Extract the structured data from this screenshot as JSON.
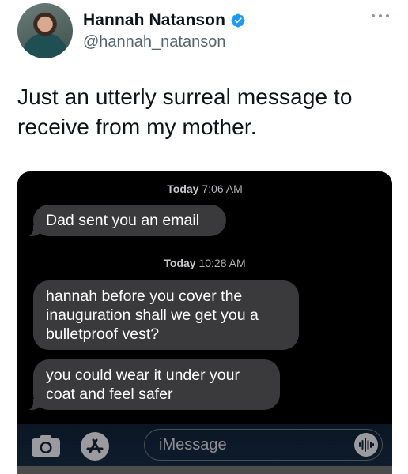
{
  "author": {
    "display_name": "Hannah Natanson",
    "handle": "@hannah_natanson",
    "verified": true,
    "verified_color": "#1d9bf0"
  },
  "tweet": {
    "text": "Just an utterly surreal message to receive from my mother."
  },
  "screenshot": {
    "messages": [
      {
        "timestamp_day": "Today",
        "timestamp_time": "7:06 AM"
      },
      {
        "bubble": "Dad sent you an email"
      },
      {
        "timestamp_day": "Today",
        "timestamp_time": "10:28 AM"
      },
      {
        "bubble": "hannah before you cover the inauguration shall we get you a bulletproof vest?"
      },
      {
        "bubble": "you could wear it under your coat and feel safer"
      }
    ],
    "input": {
      "placeholder": "iMessage"
    }
  },
  "icons": {
    "more": "more-icon",
    "verified": "verified-badge-icon",
    "camera": "camera-icon",
    "app_store": "app-store-icon",
    "audio": "audio-message-icon"
  }
}
